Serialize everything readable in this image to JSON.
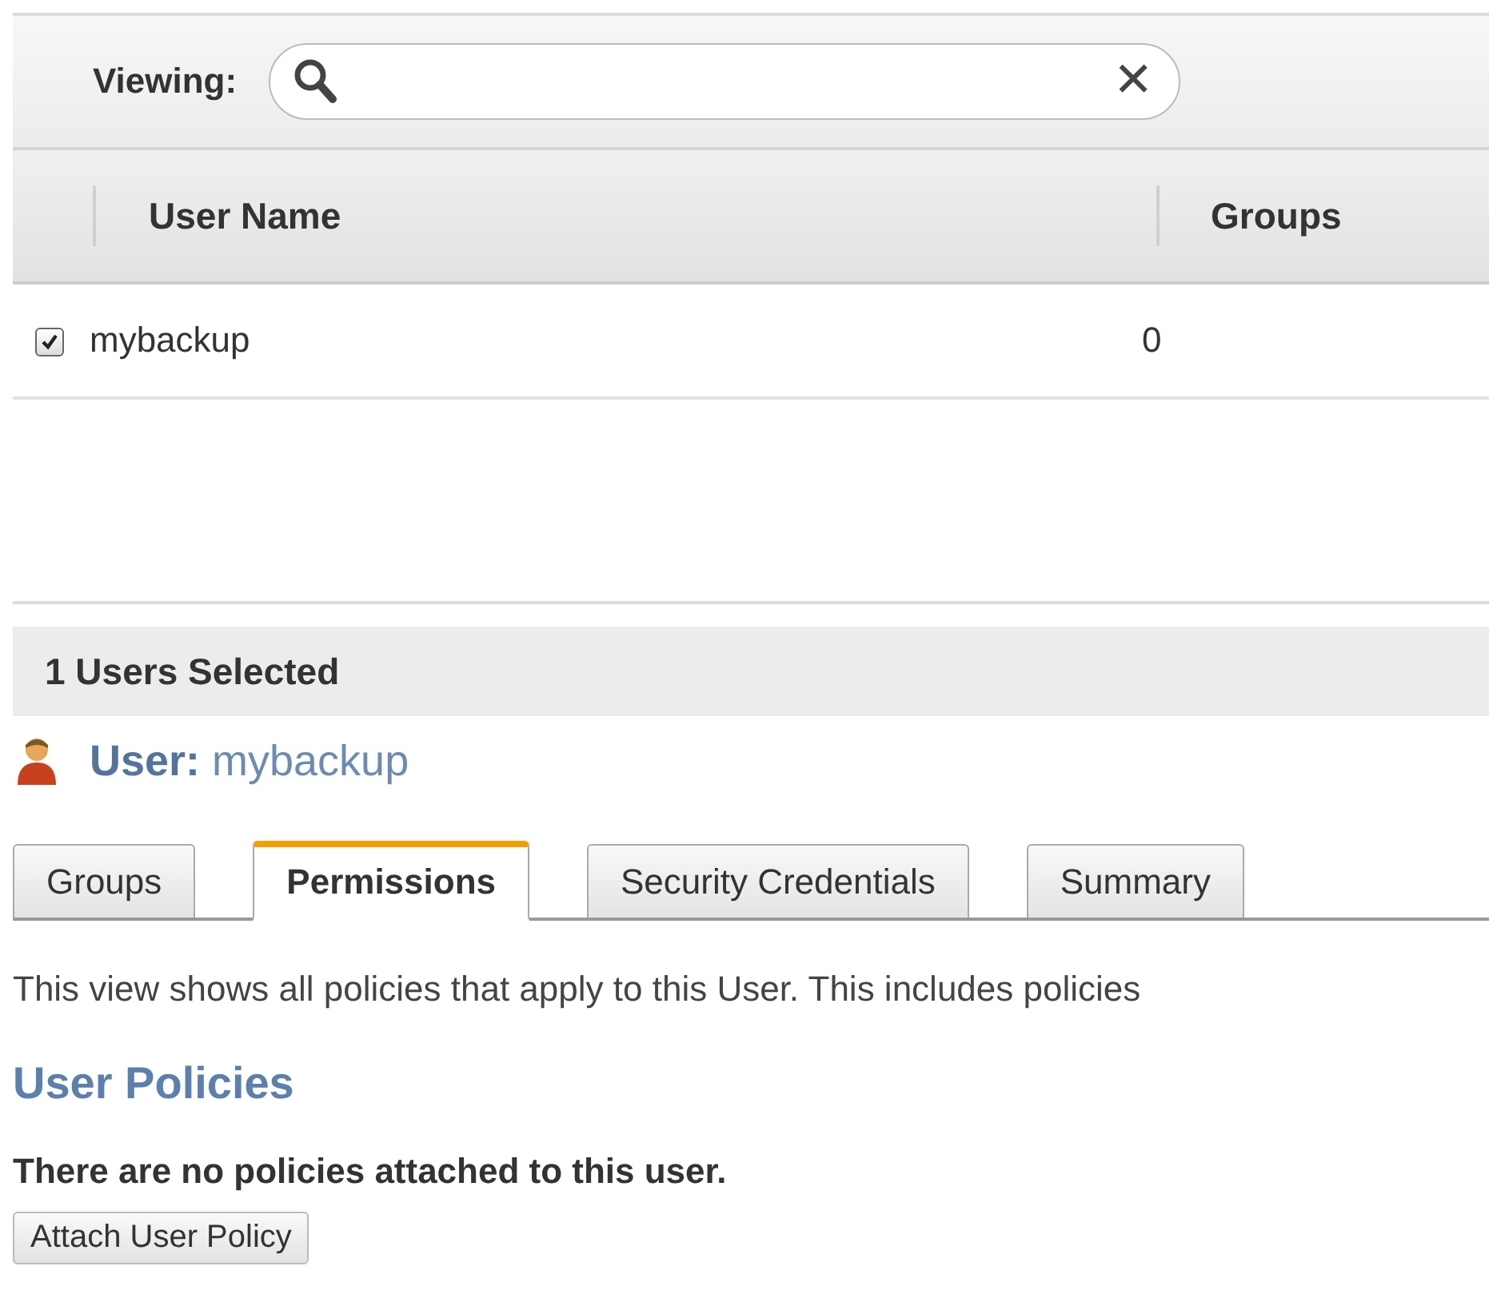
{
  "filter": {
    "label": "Viewing:",
    "clear": "✕"
  },
  "table": {
    "columns": [
      "User Name",
      "Groups"
    ],
    "rows": [
      {
        "checked": true,
        "user_name": "mybackup",
        "groups": "0"
      }
    ]
  },
  "selection": {
    "summary": "1 Users Selected",
    "user_label": "User:",
    "user_name": "mybackup"
  },
  "tabs": [
    {
      "label": "Groups",
      "selected": false
    },
    {
      "label": "Permissions",
      "selected": true
    },
    {
      "label": "Security Credentials",
      "selected": false
    },
    {
      "label": "Summary",
      "selected": false
    }
  ],
  "permissions": {
    "description": "This view shows all policies that apply to this User. This includes policies",
    "heading": "User Policies",
    "empty_message": "There are no policies attached to this user.",
    "button": "Attach User Policy"
  }
}
